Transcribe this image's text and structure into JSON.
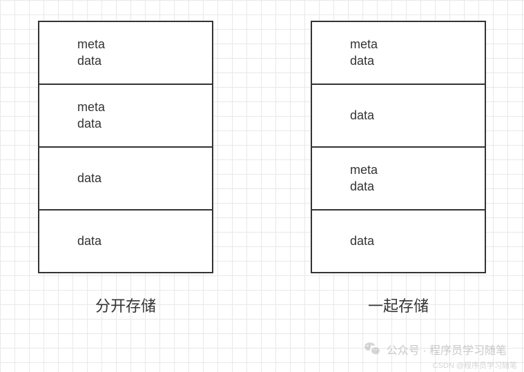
{
  "columns": [
    {
      "boxes": [
        {
          "line1": "meta",
          "line2": "data"
        },
        {
          "line1": "meta",
          "line2": "data"
        },
        {
          "line1": "data",
          "line2": ""
        },
        {
          "line1": "data",
          "line2": ""
        }
      ],
      "caption": "分开存储"
    },
    {
      "boxes": [
        {
          "line1": "meta",
          "line2": "data"
        },
        {
          "line1": "data",
          "line2": ""
        },
        {
          "line1": "meta",
          "line2": "data"
        },
        {
          "line1": "data",
          "line2": ""
        }
      ],
      "caption": "一起存储"
    }
  ],
  "watermark": {
    "text": "公众号 · 程序员学习随笔",
    "csdn": "CSDN @程序员学习随笔"
  }
}
